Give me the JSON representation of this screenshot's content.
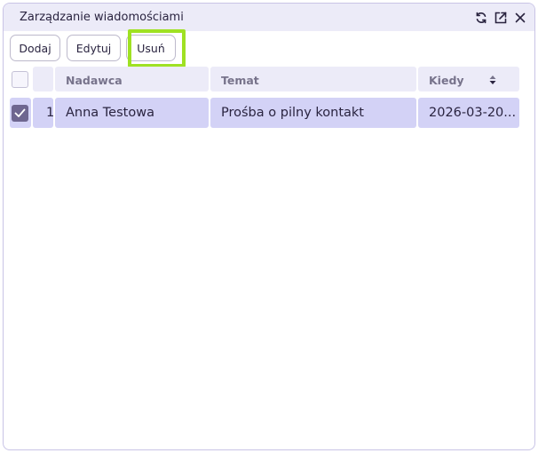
{
  "window": {
    "title": "Zarządzanie wiadomościami",
    "icons": [
      "refresh-icon",
      "external-link-icon",
      "close-icon"
    ]
  },
  "toolbar": {
    "add_label": "Dodaj",
    "edit_label": "Edytuj",
    "delete_label": "Usuń"
  },
  "table": {
    "columns": [
      {
        "label": "Nadawca"
      },
      {
        "label": "Temat"
      },
      {
        "label": "Kiedy",
        "sort_icon": "sort-icon"
      }
    ],
    "rows": [
      {
        "selected": true,
        "index": "1",
        "sender": "Anna Testowa",
        "subject": "Prośba o pilny kontakt",
        "when": "2026-03-20..."
      }
    ]
  },
  "colors": {
    "accent_highlight": "#9fe123",
    "header_bg": "#ecebf8",
    "selected_row_bg": "#d3d2f6",
    "checkbox_checked": "#6e6690"
  }
}
